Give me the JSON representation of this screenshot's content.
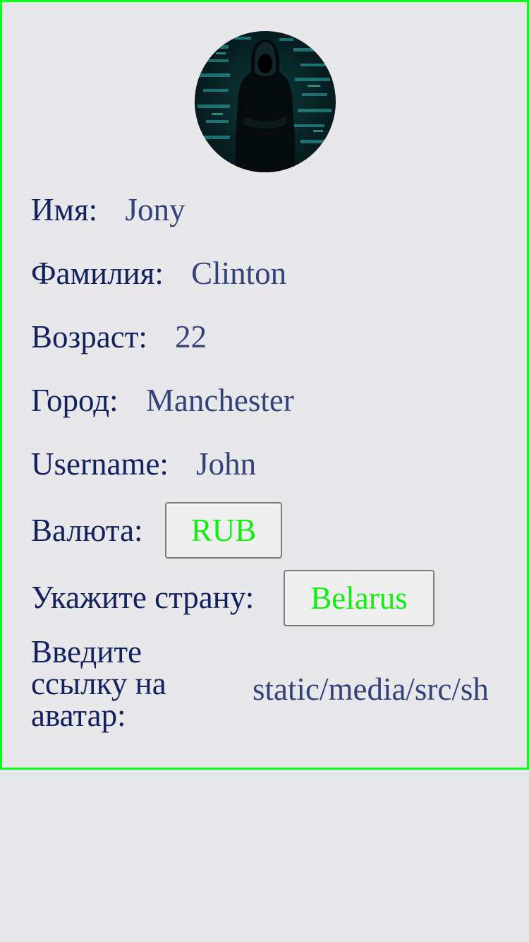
{
  "profile": {
    "avatar_alt": "avatar",
    "fields": [
      {
        "label": "Имя:",
        "value": "Jony"
      },
      {
        "label": "Фамилия:",
        "value": "Clinton"
      },
      {
        "label": "Возраст:",
        "value": "22"
      },
      {
        "label": "Город:",
        "value": "Manchester"
      },
      {
        "label": "Username:",
        "value": "John"
      }
    ],
    "currency": {
      "label": "Валюта:",
      "value": "RUB"
    },
    "country": {
      "label": "Укажите страну:",
      "value": "Belarus"
    },
    "avatar_link": {
      "label": "Введите ссылку на аватар:",
      "value": "static/media/src/sh"
    }
  },
  "colors": {
    "border": "#0aff1a",
    "label": "#11215f",
    "value": "#34427b",
    "button_text": "#12ed12",
    "background": "#e8e7ea"
  }
}
